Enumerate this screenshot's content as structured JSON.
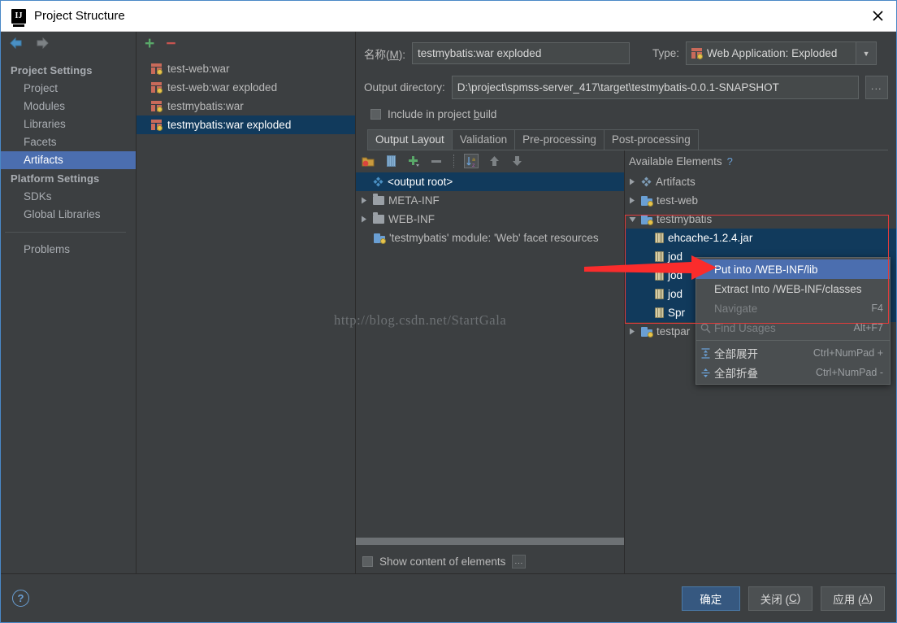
{
  "window": {
    "title": "Project Structure",
    "close_label": "✕"
  },
  "nav": {
    "back_icon": "arrow-left-icon",
    "forward_icon": "arrow-right-icon"
  },
  "sidebar": {
    "groups": [
      {
        "label": "Project Settings",
        "items": [
          {
            "label": "Project",
            "selected": false
          },
          {
            "label": "Modules",
            "selected": false
          },
          {
            "label": "Libraries",
            "selected": false
          },
          {
            "label": "Facets",
            "selected": false
          },
          {
            "label": "Artifacts",
            "selected": true
          }
        ]
      },
      {
        "label": "Platform Settings",
        "items": [
          {
            "label": "SDKs",
            "selected": false
          },
          {
            "label": "Global Libraries",
            "selected": false
          }
        ]
      }
    ],
    "problems": {
      "label": "Problems"
    }
  },
  "artifacts": {
    "toolbar": {
      "add_label": "+",
      "remove_label": "−"
    },
    "items": [
      {
        "label": "test-web:war",
        "selected": false
      },
      {
        "label": "test-web:war exploded",
        "selected": false
      },
      {
        "label": "testmybatis:war",
        "selected": false
      },
      {
        "label": "testmybatis:war exploded",
        "selected": true
      }
    ]
  },
  "detail": {
    "name_label": "名称(M):",
    "name_label_plain": "名称(",
    "name_label_mnemonic": "M",
    "name_label_tail": "):",
    "name_value": "testmybatis:war exploded",
    "type_label": "Type:",
    "type_value": "Web Application: Exploded",
    "type_arrow": "▼",
    "output_dir_label": "Output directory:",
    "output_dir_value": "D:\\project\\spmss-server_417\\target\\testmybatis-0.0.1-SNAPSHOT",
    "browse_label": "...",
    "include_label_a": "Include in project ",
    "include_label_mnemonic": "b",
    "include_label_b": "uild",
    "include_checked": false,
    "tabs": [
      {
        "label": "Output Layout",
        "active": true
      },
      {
        "label": "Validation",
        "active": false
      },
      {
        "label": "Pre-processing",
        "active": false
      },
      {
        "label": "Post-processing",
        "active": false
      }
    ]
  },
  "layout_toolbar": {
    "buttons": [
      {
        "name": "add-directory-icon",
        "icon": "folder-red"
      },
      {
        "name": "add-archive-icon",
        "icon": "archive"
      },
      {
        "name": "add-copy-icon",
        "icon": "plus-dropdown",
        "label": "+"
      },
      {
        "name": "remove-icon",
        "icon": "minus",
        "label": "−"
      },
      {
        "name": "sort-az-icon",
        "icon": "sort-az",
        "active": true
      },
      {
        "name": "move-up-icon",
        "icon": "arrow-up"
      },
      {
        "name": "move-down-icon",
        "icon": "arrow-down"
      }
    ]
  },
  "output_tree": {
    "nodes": [
      {
        "label": "<output root>",
        "icon": "artifact-diamond-icon",
        "indent": 1,
        "twisty": "none",
        "selected": true
      },
      {
        "label": "META-INF",
        "icon": "folder-icon",
        "indent": 1,
        "twisty": "collapsed",
        "selected": false
      },
      {
        "label": "WEB-INF",
        "icon": "folder-icon",
        "indent": 1,
        "twisty": "collapsed",
        "selected": false
      },
      {
        "label": "'testmybatis' module: 'Web' facet resources",
        "icon": "module-icon",
        "indent": 2,
        "twisty": "none",
        "selected": false
      }
    ]
  },
  "available": {
    "header": "Available Elements",
    "help_icon": "?",
    "nodes": [
      {
        "label": "Artifacts",
        "icon": "artifact-diamond-icon",
        "indent": 1,
        "twisty": "collapsed",
        "selected": false
      },
      {
        "label": "test-web",
        "icon": "module-icon",
        "indent": 1,
        "twisty": "collapsed",
        "selected": false
      },
      {
        "label": "testmybatis",
        "icon": "module-icon",
        "indent": 1,
        "twisty": "expanded",
        "selected": false
      },
      {
        "label": "ehcache-1.2.4.jar",
        "icon": "jar-icon",
        "indent": 3,
        "twisty": "none",
        "selected": true
      },
      {
        "label": "jod",
        "icon": "jar-icon",
        "indent": 3,
        "twisty": "none",
        "selected": true
      },
      {
        "label": "jod",
        "icon": "jar-icon",
        "indent": 3,
        "twisty": "none",
        "selected": true
      },
      {
        "label": "jod",
        "icon": "jar-icon",
        "indent": 3,
        "twisty": "none",
        "selected": true
      },
      {
        "label": "Spr",
        "icon": "jar-icon",
        "indent": 3,
        "twisty": "none",
        "selected": true
      },
      {
        "label": "testpar",
        "icon": "module-icon",
        "indent": 1,
        "twisty": "collapsed",
        "selected": false
      }
    ]
  },
  "context_menu": {
    "items": [
      {
        "label": "Put into /WEB-INF/lib",
        "accel": "",
        "selected": true,
        "disabled": false,
        "icon": ""
      },
      {
        "label": "Extract Into /WEB-INF/classes",
        "accel": "",
        "selected": false,
        "disabled": false,
        "icon": ""
      },
      {
        "label": "Navigate",
        "accel": "F4",
        "selected": false,
        "disabled": true,
        "icon": ""
      },
      {
        "label": "Find Usages",
        "accel": "Alt+F7",
        "selected": false,
        "disabled": true,
        "icon": "search-icon"
      },
      {
        "label": "全部展开",
        "accel": "Ctrl+NumPad +",
        "selected": false,
        "disabled": false,
        "icon": "expand-all-icon"
      },
      {
        "label": "全部折叠",
        "accel": "Ctrl+NumPad -",
        "selected": false,
        "disabled": false,
        "icon": "collapse-all-icon"
      }
    ]
  },
  "bottom": {
    "show_content_label": "Show content of elements",
    "show_content_checked": false,
    "more_label": "..."
  },
  "footer": {
    "help_label": "?",
    "ok_label": "确定",
    "close_label_a": "关闭 (",
    "close_label_mnemonic": "C",
    "close_label_b": ")",
    "apply_label_a": "应用 (",
    "apply_label_mnemonic": "A",
    "apply_label_b": ")"
  },
  "annotations": {
    "watermark": "http://blog.csdn.net/StartGala",
    "highlight_color": "#e33b3b",
    "arrow_color": "#fa2c2c"
  },
  "colors": {
    "window_bg": "#3c3f41",
    "selection_blue": "#4b6eaf",
    "tree_selection": "#113a5c",
    "accent_border": "#4a88c7",
    "ok_button": "#365880"
  }
}
